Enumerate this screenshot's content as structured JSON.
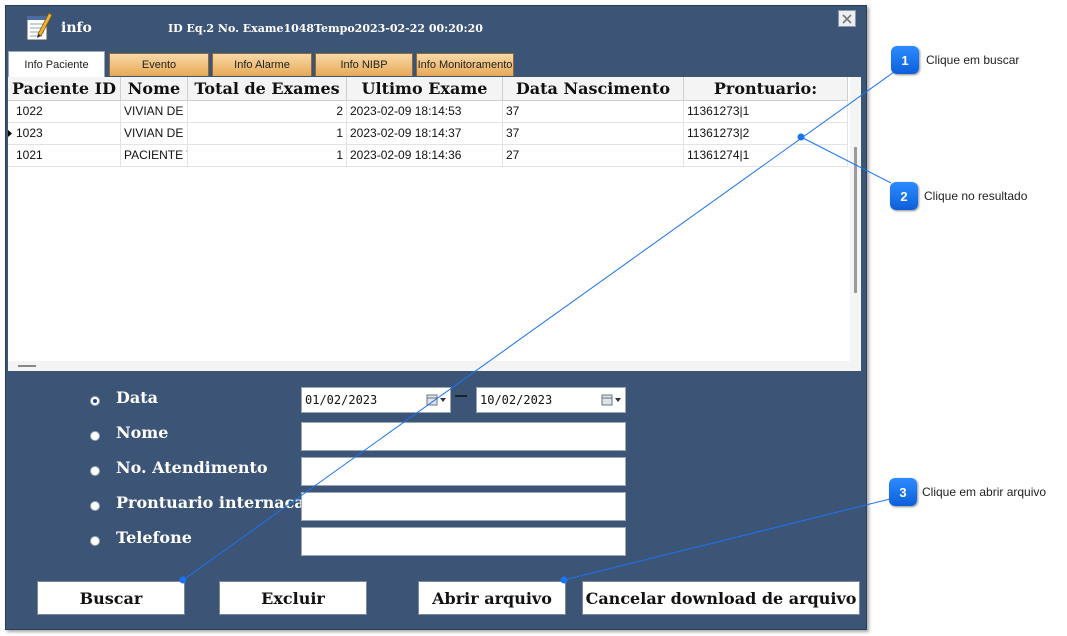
{
  "window": {
    "title": "info",
    "subtitle": "ID Eq.2  No. Exame1048Tempo2023-02-22 00:20:20"
  },
  "tabs": [
    {
      "label": "Info Paciente",
      "active": true
    },
    {
      "label": "Evento",
      "active": false
    },
    {
      "label": "Info Alarme",
      "active": false
    },
    {
      "label": "Info NIBP",
      "active": false
    },
    {
      "label": "Info Monitoramento",
      "active": false
    }
  ],
  "table": {
    "columns": [
      "Paciente ID",
      "Nome",
      "Total de Exames",
      "Ultimo Exame",
      "Data Nascimento",
      "Prontuario:"
    ],
    "rows": [
      [
        "1022",
        "VIVIAN DE",
        "2",
        "2023-02-09 18:14:53",
        "37",
        "11361273|1"
      ],
      [
        "1023",
        "VIVIAN DE",
        "1",
        "2023-02-09 18:14:37",
        "37",
        "11361273|2"
      ],
      [
        "1021",
        "PACIENTE T",
        "1",
        "2023-02-09 18:14:36",
        "27",
        "11361274|1"
      ]
    ],
    "current_row": 1
  },
  "search": {
    "options": [
      {
        "label": "Data",
        "checked": true
      },
      {
        "label": "Nome",
        "checked": false
      },
      {
        "label": "No. Atendimento",
        "checked": false
      },
      {
        "label": "Prontuario internacao",
        "checked": false
      },
      {
        "label": "Telefone",
        "checked": false
      }
    ],
    "date_from": "01/02/2023",
    "date_to": "10/02/2023",
    "nome": "",
    "atendimento": "",
    "prontuario": "",
    "telefone": ""
  },
  "buttons": {
    "buscar": "Buscar",
    "excluir": "Excluir",
    "abrir": "Abrir arquivo",
    "cancelar": "Cancelar download de arquivo"
  },
  "callouts": [
    {
      "number": "1",
      "text": "Clique em buscar"
    },
    {
      "number": "2",
      "text": "Clique no resultado"
    },
    {
      "number": "3",
      "text": "Clique em abrir arquivo"
    }
  ],
  "colors": {
    "window_bg": "#3c5577",
    "tab_inactive": "#e7a957",
    "callout": "#1a73f0"
  }
}
